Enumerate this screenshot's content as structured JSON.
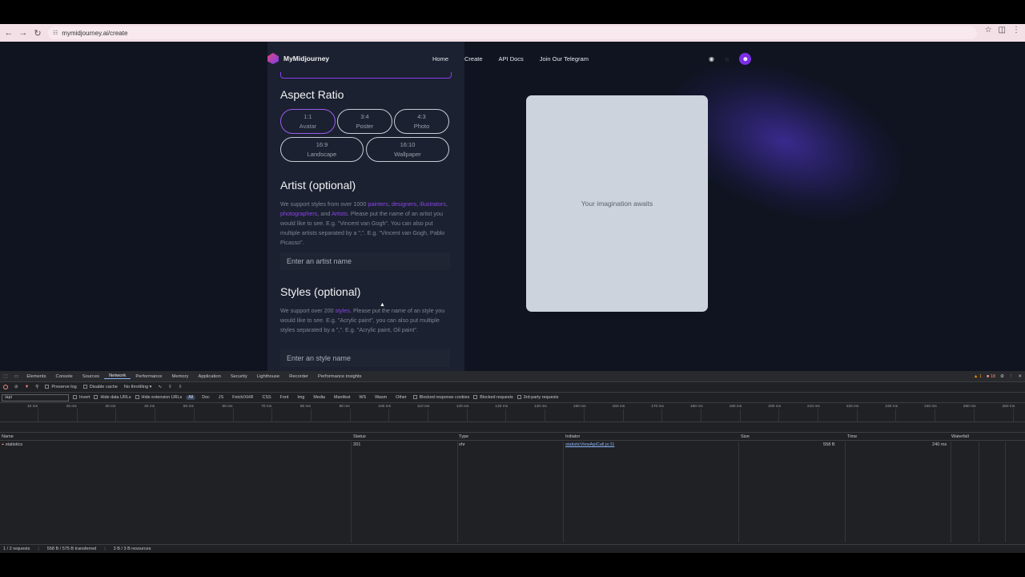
{
  "browser": {
    "url": "mymidjourney.ai/create"
  },
  "site": {
    "brand": "MyMidjourney",
    "nav": [
      "Home",
      "Create",
      "API Docs",
      "Join Our Telegram"
    ]
  },
  "aspect_ratio": {
    "heading": "Aspect Ratio",
    "options": [
      {
        "ratio": "1:1",
        "label": "Avatar",
        "selected": true
      },
      {
        "ratio": "3:4",
        "label": "Poster"
      },
      {
        "ratio": "4:3",
        "label": "Photo"
      },
      {
        "ratio": "16:9",
        "label": "Landscape"
      },
      {
        "ratio": "16:10",
        "label": "Wallpaper"
      }
    ]
  },
  "artist": {
    "heading": "Artist (optional)",
    "desc_1": "We support styles from over 1000 ",
    "link_painters": "painters",
    "link_designers": "designers",
    "link_illustrators": "illustrators",
    "link_photographers": "photographers",
    "link_artists": "Artists",
    "desc_2": ". Please put the name of an artist you would like to see. E.g. \"Vincent van Gogh\". You can also put multiple artists separated by a \",\". E.g. \"Vincent van Gogh, Pablo Picasso\".",
    "placeholder": "Enter an artist name"
  },
  "styles": {
    "heading": "Styles (optional)",
    "desc_1": "We support over 200 ",
    "link_styles": "styles",
    "desc_2": ". Please put the name of an style you would like to see. E.g. \"Acrylic paint\", you can also put multiple styles separated by a \",\". E.g. \"Acrylic paint, Oil paint\".",
    "placeholder": "Enter an style name"
  },
  "preview": {
    "text": "Your imagination awaits"
  },
  "devtools": {
    "tabs": [
      "Elements",
      "Console",
      "Sources",
      "Network",
      "Performance",
      "Memory",
      "Application",
      "Security",
      "Lighthouse",
      "Recorder",
      "Performance insights"
    ],
    "active_tab": "Network",
    "warnings": "1",
    "errors": "18",
    "preserve_log": "Preserve log",
    "disable_cache": "Disable cache",
    "throttling": "No throttling",
    "filter_value": "/api",
    "invert": "Invert",
    "hide_data_urls": "Hide data URLs",
    "hide_ext_urls": "Hide extension URLs",
    "type_filters": [
      "All",
      "Doc",
      "JS",
      "Fetch/XHR",
      "CSS",
      "Font",
      "Img",
      "Media",
      "Manifest",
      "WS",
      "Wasm",
      "Other"
    ],
    "blocked_cookies": "Blocked response cookies",
    "blocked_requests": "Blocked requests",
    "third_party": "3rd-party requests",
    "ticks": [
      "10 ms",
      "20 ms",
      "30 ms",
      "40 ms",
      "50 ms",
      "60 ms",
      "70 ms",
      "80 ms",
      "90 ms",
      "100 ms",
      "110 ms",
      "120 ms",
      "130 ms",
      "140 ms",
      "150 ms",
      "160 ms",
      "170 ms",
      "180 ms",
      "190 ms",
      "200 ms",
      "210 ms",
      "220 ms",
      "230 ms",
      "240 ms",
      "250 ms",
      "260 ms"
    ],
    "columns": [
      "Name",
      "Status",
      "Type",
      "Initiator",
      "Size",
      "Time",
      "Waterfall"
    ],
    "rows": [
      {
        "name": "statistics",
        "status": "201",
        "type": "xhr",
        "initiator": "statisticViewApiCall.js:11",
        "size": "558 B",
        "time": "240 ms"
      }
    ],
    "status": {
      "requests": "1 / 2 requests",
      "transferred": "558 B / 575 B transferred",
      "resources": "3 B / 3 B resources"
    }
  }
}
